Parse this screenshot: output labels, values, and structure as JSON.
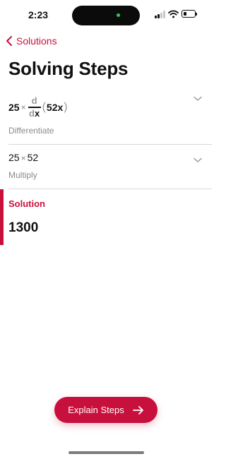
{
  "status": {
    "time": "2:23"
  },
  "nav": {
    "back_label": "Solutions"
  },
  "page": {
    "title": "Solving Steps"
  },
  "steps": [
    {
      "expression": {
        "coefficient": "25",
        "operator": "×",
        "numerator": "d",
        "denominator_d": "d",
        "denominator_var": "x",
        "open_paren": "(",
        "inner": "52x",
        "close_paren": ")"
      },
      "caption": "Differentiate"
    },
    {
      "expression": {
        "left": "25",
        "operator": "×",
        "right": "52"
      },
      "caption": "Multiply"
    }
  ],
  "solution": {
    "label": "Solution",
    "value": "1300"
  },
  "actions": {
    "explain_label": "Explain Steps"
  },
  "colors": {
    "accent": "#c8103c",
    "text": "#111111",
    "muted": "#8a8a8a",
    "divider": "#d8d8d8"
  },
  "icons": {
    "back": "chevron-left-icon",
    "expand": "chevron-down-icon",
    "explain": "arrow-right-icon"
  }
}
